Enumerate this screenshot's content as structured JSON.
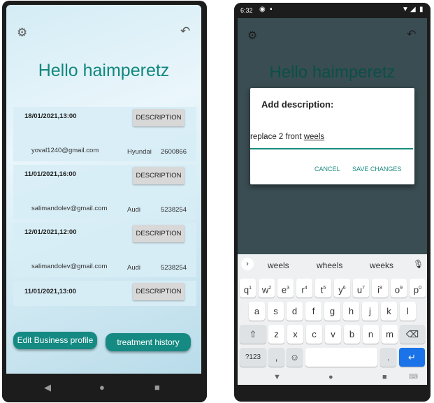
{
  "left_phone": {
    "greeting": "Hello haimperetz",
    "description_label": "DESCRIPTION",
    "appointments": [
      {
        "datetime": "18/01/2021,13:00",
        "email": "yoval1240@gmail.com",
        "car": "Hyundai",
        "number": "2600866"
      },
      {
        "datetime": "11/01/2021,16:00",
        "email": "salimandolev@gmail.com",
        "car": "Audi",
        "number": "5238254"
      },
      {
        "datetime": "12/01/2021,12:00",
        "email": "salimandolev@gmail.com",
        "car": "Audi",
        "number": "5238254"
      },
      {
        "datetime": "11/01/2021,13:00"
      }
    ],
    "edit_profile_button": "Edit Business profile",
    "treatment_history_button": "treatment history"
  },
  "right_phone": {
    "status_time": "6:32",
    "greeting": "Hello haimperetz",
    "dialog": {
      "title": "Add description:",
      "input_text": "replace 2 front ",
      "input_underlined_word": "weels",
      "cancel": "CANCEL",
      "save": "SAVE CHANGES"
    },
    "keyboard": {
      "suggestions": [
        "weels",
        "wheels",
        "weeks"
      ],
      "row1": [
        "q",
        "w",
        "e",
        "r",
        "t",
        "y",
        "u",
        "i",
        "o",
        "p"
      ],
      "row1_hints": [
        "1",
        "2",
        "3",
        "4",
        "5",
        "6",
        "7",
        "8",
        "9",
        "0"
      ],
      "row2": [
        "a",
        "s",
        "d",
        "f",
        "g",
        "h",
        "j",
        "k",
        "l"
      ],
      "row3": [
        "z",
        "x",
        "c",
        "v",
        "b",
        "n",
        "m"
      ],
      "symbols_key": "?123",
      "comma": ",",
      "period": "."
    }
  },
  "colors": {
    "accent": "#158a83",
    "title": "#12877d",
    "dialog_action": "#1a8c7e",
    "enter_key": "#1a73e8"
  },
  "icons": [
    "gear-icon",
    "back-arrow-icon",
    "nav-back-icon",
    "nav-home-icon",
    "nav-recents-icon",
    "wifi-icon",
    "signal-icon",
    "battery-icon",
    "mic-icon",
    "emoji-icon",
    "shift-icon",
    "backspace-icon",
    "enter-icon",
    "chevron-right-icon",
    "keyboard-icon"
  ]
}
